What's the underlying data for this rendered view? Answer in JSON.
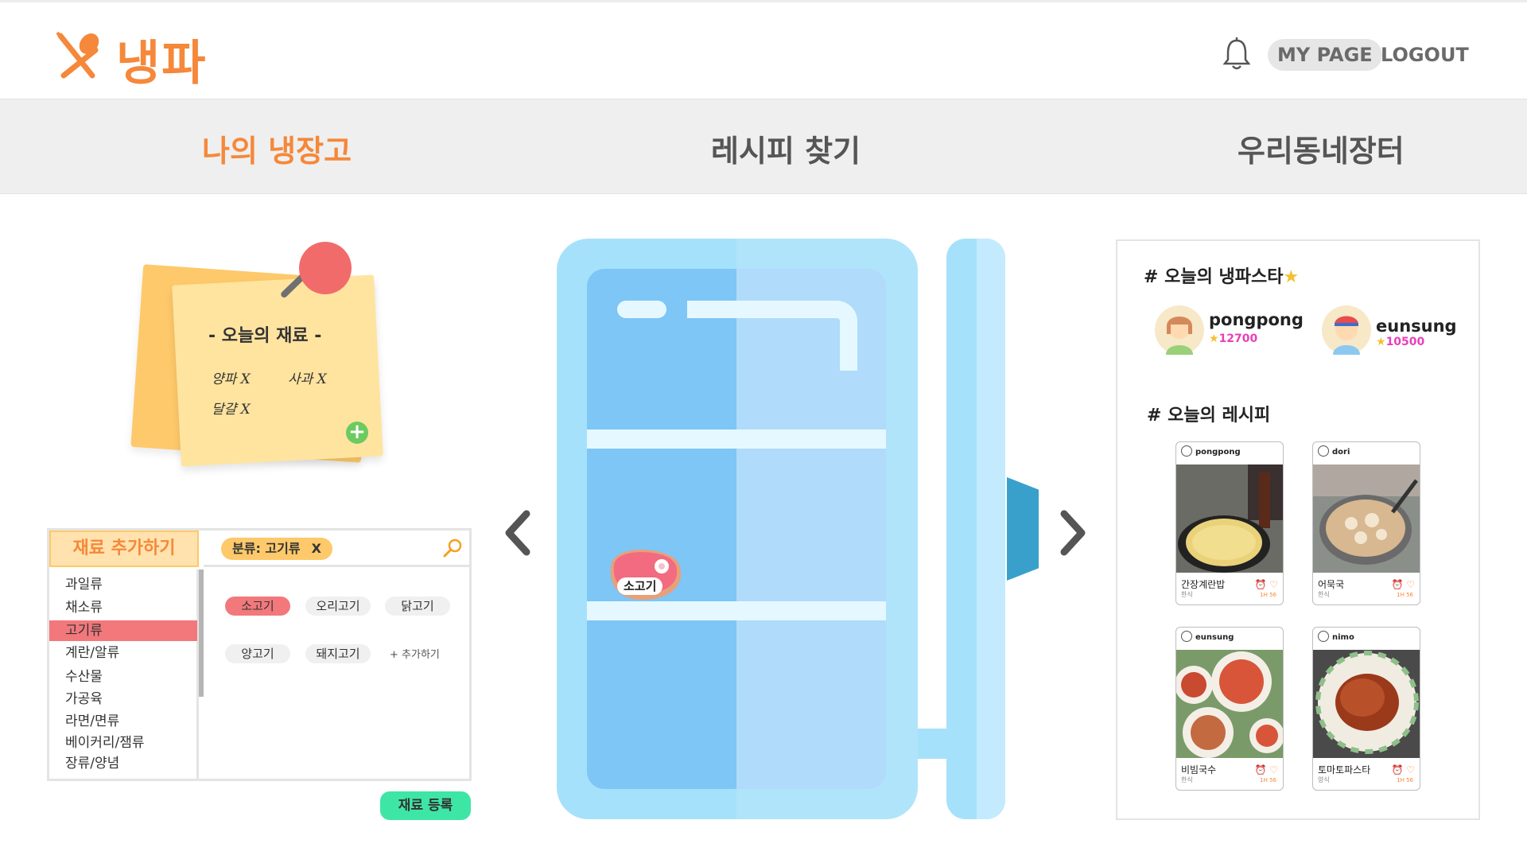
{
  "header": {
    "logo_text": "냉파",
    "mypage_label": "MY PAGE",
    "logout_label": "LOGOUT"
  },
  "nav": {
    "tabs": [
      {
        "label": "나의 냉장고",
        "active": true
      },
      {
        "label": "레시피 찾기",
        "active": false
      },
      {
        "label": "우리동네장터",
        "active": false
      }
    ]
  },
  "sticky": {
    "title": "- 오늘의 재료 -",
    "items": [
      "양파 X",
      "사과 X",
      "달걀 X"
    ]
  },
  "ingredient_panel": {
    "title": "재료 추가하기",
    "filter_label": "분류: 고기류",
    "filter_remove": "X",
    "categories": [
      "과일류",
      "채소류",
      "고기류",
      "계란/알류",
      "수산물",
      "가공육",
      "라면/면류",
      "베이커리/잼류",
      "장류/양념"
    ],
    "selected_category": "고기류",
    "chips": [
      "소고기",
      "오리고기",
      "닭고기",
      "양고기",
      "돼지고기"
    ],
    "selected_chip": "소고기",
    "add_more_label": "+ 추가하기",
    "register_label": "재료 등록"
  },
  "fridge": {
    "item_label": "소고기"
  },
  "stars": {
    "title": "# 오늘의 냉파스타",
    "users": [
      {
        "name": "pongpong",
        "score": "12700"
      },
      {
        "name": "eunsung",
        "score": "10500"
      }
    ]
  },
  "recipes": {
    "title": "# 오늘의 레시피",
    "cards": [
      {
        "user": "pongpong",
        "title": "간장계란밥",
        "category": "한식",
        "meta": "1H 56"
      },
      {
        "user": "dori",
        "title": "어묵국",
        "category": "한식",
        "meta": "1H 56"
      },
      {
        "user": "eunsung",
        "title": "비빔국수",
        "category": "한식",
        "meta": "1H 56"
      },
      {
        "user": "nimo",
        "title": "토마토파스타",
        "category": "양식",
        "meta": "1H 56"
      }
    ]
  },
  "colors": {
    "accent": "#f5883a",
    "fridge": "#a6e1fb",
    "chip_selected": "#f2787c",
    "register": "#3ee6a6"
  }
}
